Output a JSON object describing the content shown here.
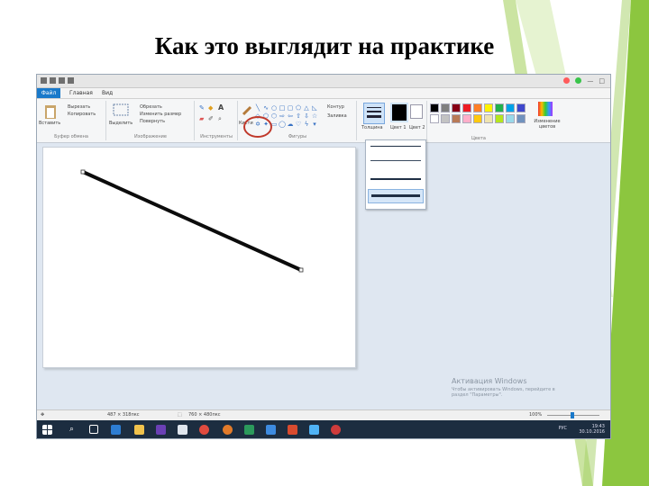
{
  "slide": {
    "title": "Как это выглядит на практике"
  },
  "colors": {
    "accent_green": "#8cc63f",
    "accent_green_light": "#b5d97a",
    "file_tab": "#1979ca",
    "highlight": "#c0392b",
    "taskbar": "#1c2d40"
  },
  "app": {
    "tabs": [
      "Файл",
      "Главная",
      "Вид"
    ],
    "clipboard": {
      "paste": "Вставить",
      "cut": "Вырезать",
      "copy": "Копировать",
      "label": "Буфер обмена"
    },
    "image": {
      "select": "Выделить",
      "crop": "Обрезать",
      "resize": "Изменить размер",
      "rotate": "Повернуть",
      "label": "Изображение"
    },
    "tools": {
      "label": "Инструменты"
    },
    "shapes": {
      "brushes": "Кисти",
      "outline": "Контур",
      "fill": "Заливка",
      "label": "Фигуры"
    },
    "colors_group": {
      "thickness": "Толщина",
      "color1": "Цвет 1",
      "color2": "Цвет 2",
      "edit": "Изменение цветов",
      "label": "Цвета",
      "palette": [
        "#000000",
        "#7f7f7f",
        "#880015",
        "#ed1c24",
        "#ff7f27",
        "#fff200",
        "#22b14c",
        "#00a2e8",
        "#3f48cc",
        "#ffffff",
        "#c3c3c3",
        "#b97a57",
        "#ffaec9",
        "#ffc90e",
        "#efe4b0",
        "#b5e61d",
        "#99d9ea",
        "#7092be"
      ]
    },
    "activation": {
      "title": "Активация Windows",
      "line1": "Чтобы активировать Windows, перейдите в",
      "line2": "раздел \"Параметры\"."
    },
    "status": {
      "position": "487 × 318пкс",
      "size": "760 × 480пкс",
      "zoom": "100%"
    },
    "tray": {
      "lang": "РУС",
      "time": "19:43",
      "date": "30.10.2016"
    }
  }
}
